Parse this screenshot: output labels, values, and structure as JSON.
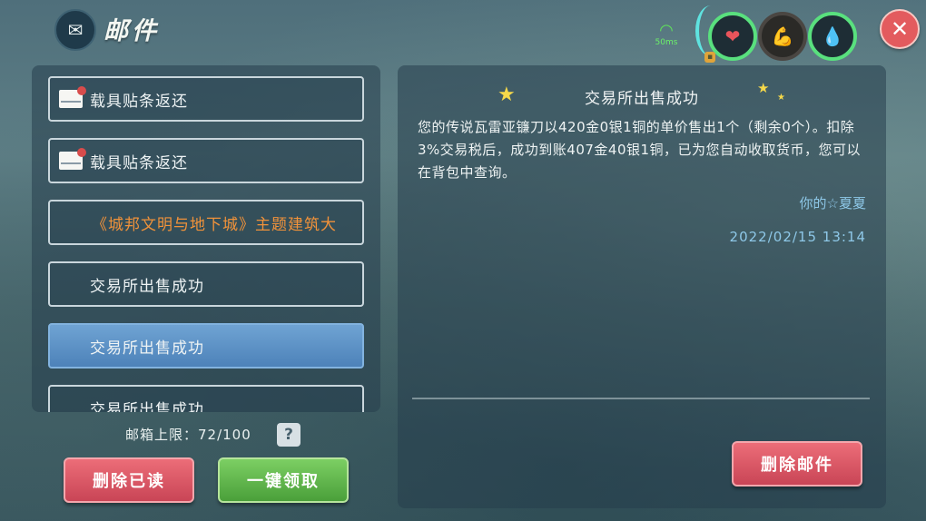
{
  "window": {
    "title": "邮件",
    "title_icon": "mailbox-icon",
    "close_icon": "close-icon"
  },
  "status": {
    "ping": "50ms",
    "indicators": [
      "heart-icon",
      "stamina-icon",
      "water-drop-icon"
    ]
  },
  "mail_list": {
    "items": [
      {
        "label": "载具贴条返还",
        "icon": "envelope-icon",
        "selected": false
      },
      {
        "label": "载具贴条返还",
        "icon": "envelope-icon",
        "selected": false
      },
      {
        "label": "《城邦文明与地下城》主题建筑大",
        "icon": "",
        "selected": false,
        "color": "#f1923a"
      },
      {
        "label": "交易所出售成功",
        "icon": "",
        "selected": false
      },
      {
        "label": "交易所出售成功",
        "icon": "",
        "selected": true
      },
      {
        "label": "交易所出售成功",
        "icon": "",
        "selected": false
      }
    ]
  },
  "mailbox": {
    "capacity_label": "邮箱上限：72/100",
    "help": "?"
  },
  "buttons": {
    "delete_read": "删除已读",
    "claim_all": "一键领取",
    "delete_mail": "删除邮件"
  },
  "detail": {
    "title": "交易所出售成功",
    "body": "您的传说瓦雷亚镰刀以420金0银1铜的单价售出1个（剩余0个）。扣除3%交易税后，成功到账407金40银1铜，已为您自动收取货币，您可以在背包中查询。",
    "sender": "你的☆夏夏",
    "date": "2022/02/15 13:14"
  },
  "colors": {
    "accent_orange": "#f1923a",
    "selected_blue": "#4d82b9",
    "red_button": "#c94556",
    "green_button": "#4a9f3a",
    "link_blue": "#8ec8e8"
  }
}
